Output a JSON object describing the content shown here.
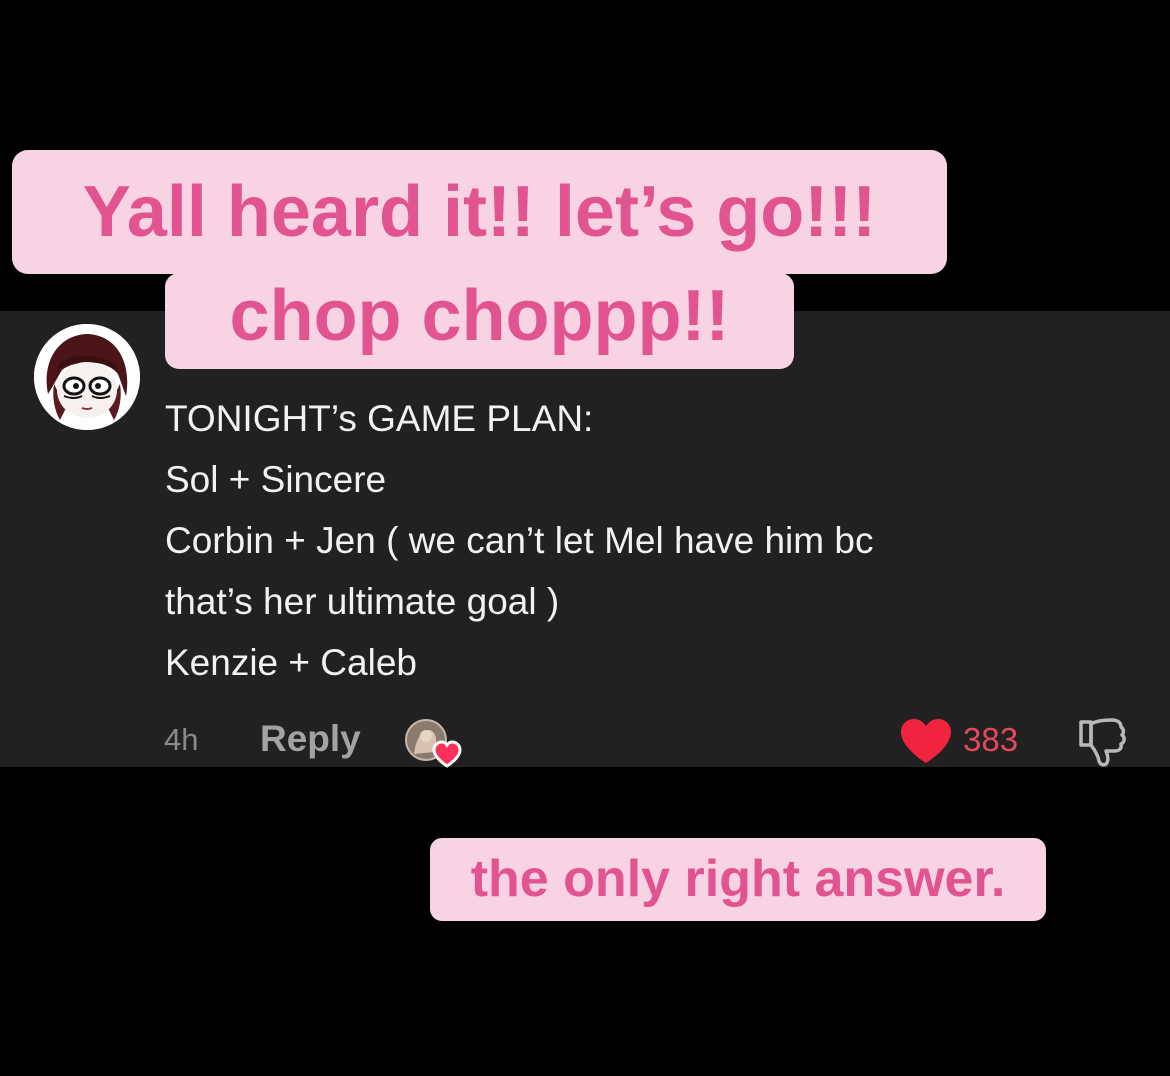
{
  "captions": {
    "line1": "Yall heard it!! let’s go!!!",
    "line2": "chop choppp!!",
    "line3": "the only right answer."
  },
  "comment": {
    "lines": [
      "TONIGHT’s GAME PLAN:",
      "Sol + Sincere",
      "Corbin + Jen ( we can’t let Mel have him bc",
      "that’s her ultimate goal )",
      "Kenzie + Caleb"
    ],
    "time": "4h",
    "reply_label": "Reply",
    "like_count": "383",
    "liked_by_creator": true,
    "liked": true
  },
  "icons": {
    "avatar": "cartoon-avatar",
    "creator_like": "creator-avatar-heart-icon",
    "like": "heart-icon",
    "dislike": "thumbs-down-icon"
  },
  "colors": {
    "caption_bg": "#f8d3e4",
    "caption_text": "#e1548f",
    "comment_bg": "#212121",
    "like_red": "#e7485d"
  }
}
